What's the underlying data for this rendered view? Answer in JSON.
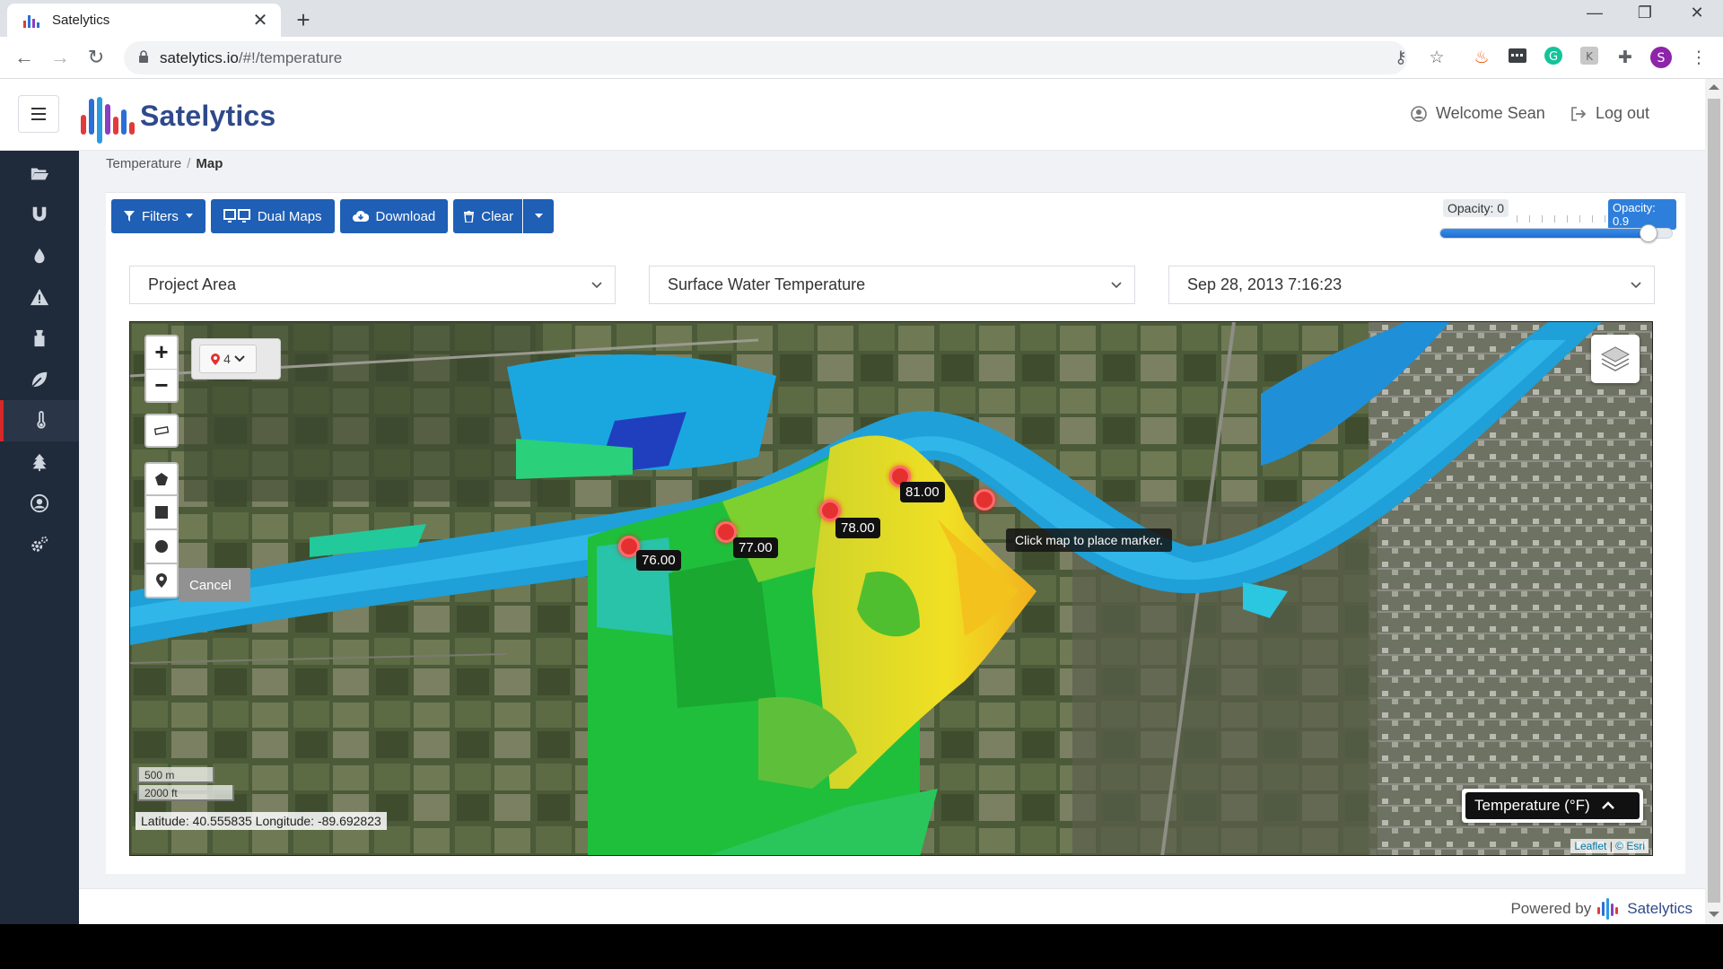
{
  "browser": {
    "tab_title": "Satelytics",
    "url_host": "satelytics.io",
    "url_path": "/#!/temperature"
  },
  "header": {
    "brand": "Satelytics",
    "welcome": "Welcome Sean",
    "logout": "Log out"
  },
  "sidebar": {
    "items": [
      {
        "icon": "folder-open-icon"
      },
      {
        "icon": "magnet-icon"
      },
      {
        "icon": "drop-icon"
      },
      {
        "icon": "warning-icon"
      },
      {
        "icon": "flask-icon"
      },
      {
        "icon": "leaf-icon"
      },
      {
        "icon": "thermometer-icon",
        "active": true
      },
      {
        "icon": "tree-icon"
      },
      {
        "icon": "user-circle-icon"
      },
      {
        "icon": "cogs-icon"
      }
    ]
  },
  "breadcrumb": {
    "parent": "Temperature",
    "current": "Map"
  },
  "toolbar": {
    "filters": "Filters",
    "dual_maps": "Dual Maps",
    "download": "Download",
    "clear": "Clear"
  },
  "opacity": {
    "min_label": "Opacity: 0",
    "value_label": "Opacity: 0.9",
    "value": 0.9
  },
  "selects": {
    "area": "Project Area",
    "measure": "Surface Water Temperature",
    "datetime": "Sep 28, 2013 7:16:23"
  },
  "map": {
    "marker_count": "4",
    "cancel": "Cancel",
    "hint": "Click map to place marker.",
    "scale_m": "500 m",
    "scale_ft": "2000 ft",
    "coords": "Latitude: 40.555835 Longitude: -89.692823",
    "legend_button": "Temperature (°F)",
    "attribution_leaflet": "Leaflet",
    "attribution_esri": "© Esri",
    "readings": [
      {
        "value": "76.00"
      },
      {
        "value": "77.00"
      },
      {
        "value": "78.00"
      },
      {
        "value": "81.00"
      }
    ]
  },
  "footer": {
    "powered_by": "Powered by",
    "brand": "Satelytics"
  },
  "colors": {
    "primary_button": "#1f5fb5",
    "sidebar_bg": "#1f2a3a",
    "active_accent": "#d62828",
    "marker": "#e53030"
  }
}
